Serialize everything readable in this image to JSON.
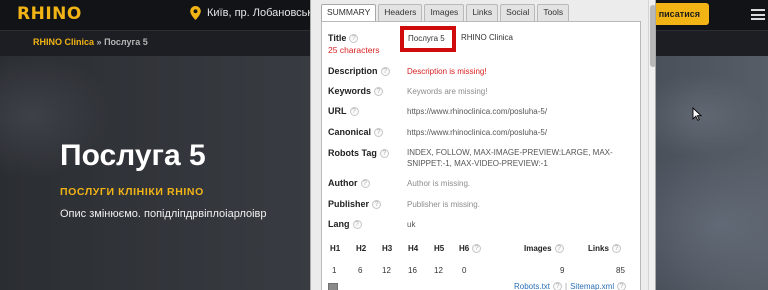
{
  "site": {
    "logo": "RHINO",
    "location": "Київ, пр. Лобановськог",
    "cta_label": "писатися",
    "breadcrumb": {
      "home": "RHINO Clinica",
      "separator": "»",
      "current": "Послуга 5"
    },
    "hero": {
      "title": "Послуга 5",
      "subtitle": "ПОСЛУГИ КЛІНІКИ RHINO",
      "description": "Опис змінюємо. попідліпдрвіплоіарлоівр"
    },
    "colors": {
      "accent": "#f2b415",
      "header_bg": "#121317"
    },
    "icons": {
      "location": "map-pin-icon",
      "menu": "hamburger-menu-icon"
    }
  },
  "panel": {
    "tabs": [
      "SUMMARY",
      "Headers",
      "Images",
      "Links",
      "Social",
      "Tools"
    ],
    "active_tab": "SUMMARY",
    "help_glyph": "?",
    "summary": {
      "title": {
        "label": "Title",
        "value_highlighted": "Послуга 5",
        "value_rest": "RHINO Clinica",
        "char_count": "25 characters"
      },
      "description": {
        "label": "Description",
        "value": "Description is missing!"
      },
      "keywords": {
        "label": "Keywords",
        "value": "Keywords are missing!"
      },
      "url": {
        "label": "URL",
        "value": "https://www.rhinoclinica.com/posluha-5/"
      },
      "canonical": {
        "label": "Canonical",
        "value": "https://www.rhinoclinica.com/posluha-5/"
      },
      "robots": {
        "label": "Robots Tag",
        "value": "INDEX, FOLLOW, MAX-IMAGE-PREVIEW:LARGE, MAX-SNIPPET:-1, MAX-VIDEO-PREVIEW:-1"
      },
      "author": {
        "label": "Author",
        "value": "Author is missing."
      },
      "publisher": {
        "label": "Publisher",
        "value": "Publisher is missing."
      },
      "lang": {
        "label": "Lang",
        "value": "uk"
      }
    },
    "stats": {
      "headers": [
        "H1",
        "H2",
        "H3",
        "H4",
        "H5",
        "H6",
        "Images",
        "Links"
      ],
      "values": [
        "1",
        "6",
        "12",
        "16",
        "12",
        "0",
        "9",
        "85"
      ]
    },
    "footer": {
      "robots_link": "Robots.txt",
      "separator": "|",
      "sitemap_link": "Sitemap.xml"
    },
    "colors": {
      "missing": "#d82020",
      "highlight_box": "#d00b0b",
      "link": "#2a6fb5"
    }
  }
}
